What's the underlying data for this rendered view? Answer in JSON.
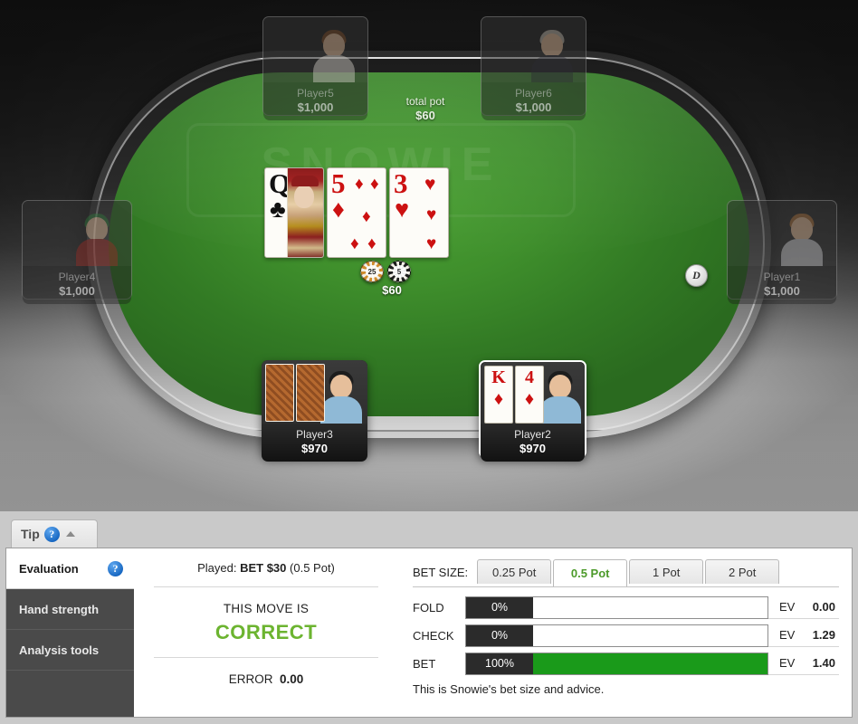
{
  "table": {
    "watermark": "SNOWIE",
    "total_pot_label": "total pot",
    "total_pot_amount": "$60",
    "pot_chips_amount": "$60",
    "dealer_button": "D",
    "chips": [
      {
        "value": "25",
        "color": "#d08b2c"
      },
      {
        "value": "5",
        "color": "#1d1d1d"
      }
    ],
    "board_cards": [
      {
        "rank": "Q",
        "suit": "♣",
        "color": "black",
        "name": "queen-of-clubs"
      },
      {
        "rank": "5",
        "suit": "♦",
        "color": "red",
        "name": "five-of-diamonds"
      },
      {
        "rank": "3",
        "suit": "♥",
        "color": "red",
        "name": "three-of-hearts"
      }
    ],
    "seats": [
      {
        "name": "Player5",
        "stack": "$1,000",
        "state": "folded"
      },
      {
        "name": "Player6",
        "stack": "$1,000",
        "state": "folded"
      },
      {
        "name": "Player4",
        "stack": "$1,000",
        "state": "folded"
      },
      {
        "name": "Player1",
        "stack": "$1,000",
        "state": "folded"
      },
      {
        "name": "Player3",
        "stack": "$970",
        "state": "active"
      },
      {
        "name": "Player2",
        "stack": "$970",
        "state": "hero"
      }
    ],
    "hero_cards": [
      {
        "rank": "K",
        "suit": "♦",
        "color": "red",
        "name": "king-of-diamonds"
      },
      {
        "rank": "4",
        "suit": "♦",
        "color": "red",
        "name": "four-of-diamonds"
      }
    ]
  },
  "tip_tab": {
    "label": "Tip",
    "help_icon": "?",
    "collapse_icon": "caret-up"
  },
  "side_tabs": [
    {
      "label": "Evaluation",
      "active": true,
      "help_icon": "?"
    },
    {
      "label": "Hand strength",
      "active": false
    },
    {
      "label": "Analysis tools",
      "active": false
    }
  ],
  "evaluation": {
    "played_prefix": "Played:",
    "played_action": "BET $30",
    "played_suffix": "(0.5 Pot)",
    "move_label": "THIS MOVE IS",
    "move_value": "CORRECT",
    "move_color": "#6cb430",
    "error_label": "ERROR",
    "error_value": "0.00"
  },
  "advice": {
    "bet_size_label": "BET SIZE:",
    "bet_size_tabs": [
      {
        "label": "0.25 Pot",
        "active": false
      },
      {
        "label": "0.5 Pot",
        "active": true
      },
      {
        "label": "1 Pot",
        "active": false
      },
      {
        "label": "2 Pot",
        "active": false
      }
    ],
    "ev_label": "EV",
    "actions": [
      {
        "name": "FOLD",
        "percent": "0%",
        "percent_value": 0,
        "ev": "0.00"
      },
      {
        "name": "CHECK",
        "percent": "0%",
        "percent_value": 0,
        "ev": "1.29"
      },
      {
        "name": "BET",
        "percent": "100%",
        "percent_value": 100,
        "ev": "1.40"
      }
    ],
    "note": "This is Snowie's bet size and advice."
  }
}
